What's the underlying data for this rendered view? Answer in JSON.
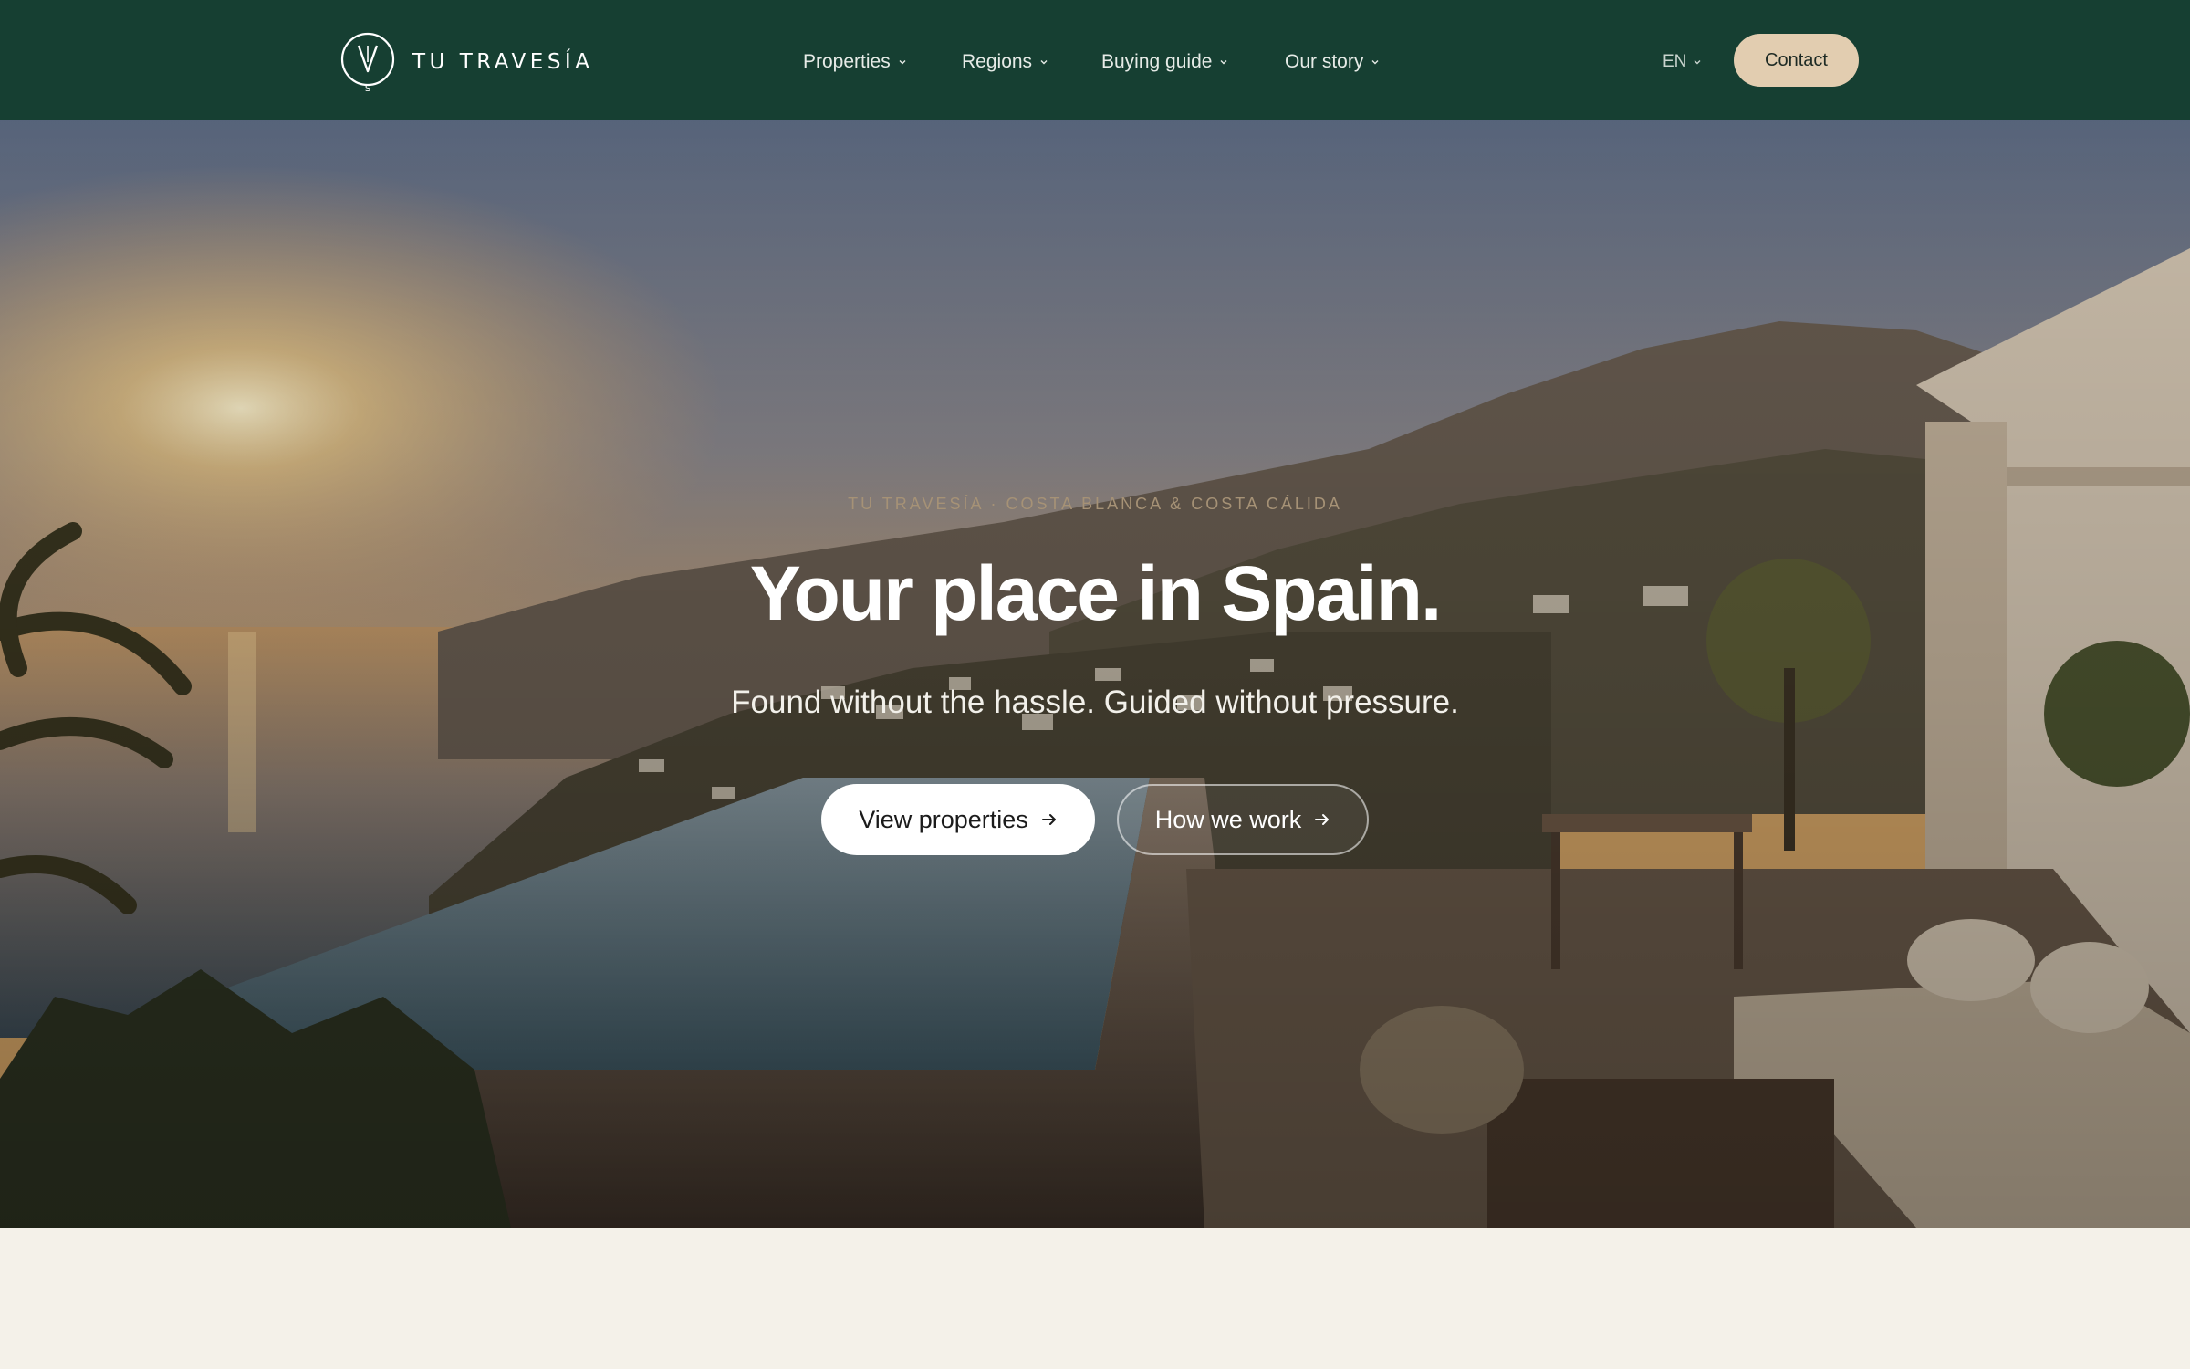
{
  "header": {
    "logo": {
      "text": "TU TRAVESÍA",
      "icon": "compass-v-icon"
    },
    "nav": [
      {
        "label": "Properties",
        "icon": "chevron-down-icon"
      },
      {
        "label": "Regions",
        "icon": "chevron-down-icon"
      },
      {
        "label": "Buying guide",
        "icon": "chevron-down-icon"
      },
      {
        "label": "Our story",
        "icon": "chevron-down-icon"
      }
    ],
    "language": {
      "label": "EN",
      "icon": "chevron-down-icon"
    },
    "contact_label": "Contact"
  },
  "hero": {
    "eyebrow": "TU TRAVESÍA · COSTA BLANCA & COSTA CÁLIDA",
    "title": "Your place in Spain.",
    "subtitle": "Found without the hassle. Guided without pressure.",
    "primary_cta": "View properties",
    "secondary_cta": "How we work",
    "cta_icon": "arrow-right-icon"
  },
  "colors": {
    "header_bg": "#163f32",
    "contact_bg": "#e2cdb0",
    "page_bg": "#f4f1e9"
  }
}
